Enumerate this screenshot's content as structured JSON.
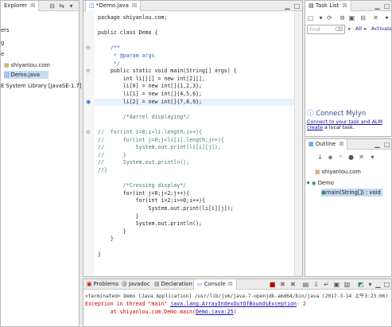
{
  "explorer": {
    "tab_label": "Explorer",
    "close": "☒",
    "items": [
      "ers",
      "g",
      "e",
      "shiyanlou.com",
      "Demo.java",
      "E System Library [JavaSE-1.7]"
    ]
  },
  "editor": {
    "tab_label": "*Demo.java",
    "close": "☒",
    "lines": [
      {
        "t": "package shiyanlou.com;",
        "k": ""
      },
      {
        "t": "",
        "k": ""
      },
      {
        "t": "public class Demo {",
        "k": ""
      },
      {
        "t": "",
        "k": ""
      },
      {
        "t": "    /**",
        "k": "jd"
      },
      {
        "t": "     * @param args",
        "k": "jd"
      },
      {
        "t": "     */",
        "k": "jd"
      },
      {
        "t": "    public static void main(String[] args) {",
        "k": ""
      },
      {
        "t": "        int li[][] = new int[2][];",
        "k": ""
      },
      {
        "t": "        li[0] = new int[]{1,2,3};",
        "k": ""
      },
      {
        "t": "        li[1] = new int[]{4,5,6};",
        "k": ""
      },
      {
        "t": "        li[2] = new int[]{7,8,9};",
        "k": "hl"
      },
      {
        "t": "",
        "k": ""
      },
      {
        "t": "        /*Aarrel displaying*/",
        "k": "cm"
      },
      {
        "t": "",
        "k": ""
      },
      {
        "t": "//  for(int i=0;i<li.length;i++){",
        "k": "cm"
      },
      {
        "t": "//      for(int j=0;j<li[i].length;j++){",
        "k": "cm"
      },
      {
        "t": "//          System.out.print(li[i][j]);",
        "k": "cm"
      },
      {
        "t": "//      }",
        "k": "cm"
      },
      {
        "t": "//      System.out.println();",
        "k": "cm"
      },
      {
        "t": "//}",
        "k": "cm"
      },
      {
        "t": "",
        "k": ""
      },
      {
        "t": "        /*Crossing display*/",
        "k": "cm"
      },
      {
        "t": "        for(int j=0;j<2;j++){",
        "k": ""
      },
      {
        "t": "            for(int i=2;i>=0;i++){",
        "k": ""
      },
      {
        "t": "                System.out.print(li[i][j]);",
        "k": ""
      },
      {
        "t": "            }",
        "k": ""
      },
      {
        "t": "            System.out.println();",
        "k": ""
      },
      {
        "t": "        }",
        "k": ""
      },
      {
        "t": "    }",
        "k": ""
      },
      {
        "t": "",
        "k": ""
      },
      {
        "t": "}",
        "k": ""
      }
    ]
  },
  "tasklist": {
    "tab_label": "Task List",
    "close": "☒",
    "find_placeholder": "Find",
    "all_label": "All",
    "activate_label": "Activate...",
    "mylyn_title": "Connect Mylyn",
    "mylyn_text1": "Connect to your task and ALM",
    "mylyn_link": "create",
    "mylyn_text2": "a local task."
  },
  "outline": {
    "tab_label": "Outline",
    "close": "☒",
    "items": [
      "shiyanlou.com",
      "Demo",
      "main(String[]) : void"
    ]
  },
  "console": {
    "tabs": [
      "Problems",
      "Javadoc",
      "Declaration",
      "Console"
    ],
    "close": "☒",
    "terminated": "<terminated> Demo [Java Application] /usr/lib/jvm/java-7-openjdk-amd64/bin/java (2017-3-14 上午3:23:06)",
    "err_prefix": "Exception in thread \"main\" ",
    "err_link": "java.lang.ArrayIndexOutOfBoundsException",
    "err_suffix": ": 2",
    "at_prefix": "        at shiyanlou.com.Demo.main(",
    "at_link": "Demo.java:25",
    "at_suffix": ")"
  },
  "colors": {
    "accent": "#1c73e8",
    "error": "#cc0000",
    "keyword": "#7f0055",
    "comment": "#3f7f5f"
  }
}
